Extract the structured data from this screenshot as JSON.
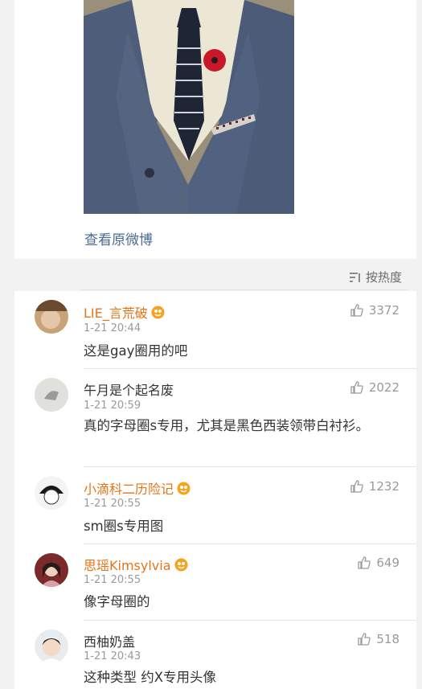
{
  "post": {
    "view_original": "查看原微博"
  },
  "sort": {
    "label": "按热度"
  },
  "comments": [
    {
      "name": "LIE_言荒破",
      "name_style": "orange",
      "badge": true,
      "time": "1-21 20:44",
      "likes": "3372",
      "text": "这是gay圈用的吧"
    },
    {
      "name": "午月是个起名废",
      "name_style": "gray",
      "badge": false,
      "time": "1-21 20:59",
      "likes": "2022",
      "text": "真的字母圈s专用，尤其是黑色西装领带白衬衫。"
    },
    {
      "name": "小滴科二历险记",
      "name_style": "orange",
      "badge": true,
      "time": "1-21 20:55",
      "likes": "1232",
      "text": "sm圈s专用图"
    },
    {
      "name": "思瑶Kimsylvia",
      "name_style": "orange",
      "badge": true,
      "time": "1-21 20:55",
      "likes": "649",
      "text": "像字母圈的"
    },
    {
      "name": "西柚奶盖",
      "name_style": "gray",
      "badge": false,
      "time": "1-21 20:43",
      "likes": "518",
      "text": "这种类型 约X专用头像"
    }
  ]
}
